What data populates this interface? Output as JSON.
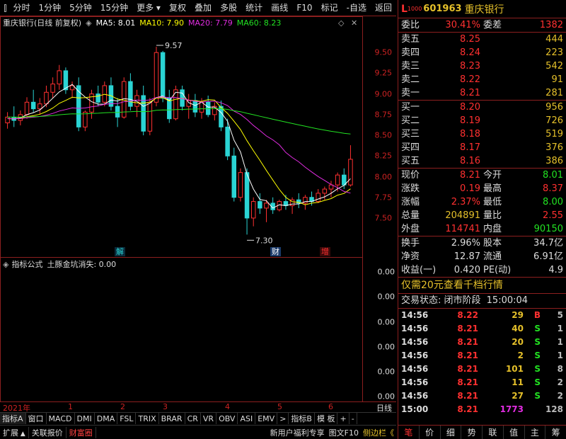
{
  "toolbar": {
    "left_items": [
      "分时",
      "1分钟",
      "5分钟",
      "15分钟",
      "更多"
    ],
    "right_items": [
      "复权",
      "叠加",
      "多股",
      "统计",
      "画线",
      "F10",
      "标记",
      "-自选",
      "返回"
    ]
  },
  "chart": {
    "stock_name": "重庆银行",
    "mode": "(日线 前复权)",
    "ma5": "MA5: 8.01",
    "ma10": "MA10: 7.90",
    "ma20": "MA20: 7.79",
    "ma60": "MA60: 8.23",
    "high_label": "9.57",
    "low_label": "7.30",
    "markers": [
      "解",
      "财",
      "增"
    ]
  },
  "chart_data": {
    "type": "candlestick",
    "y_ticks": [
      7.5,
      7.75,
      8.0,
      8.25,
      8.5,
      8.75,
      9.0,
      9.25,
      9.5
    ],
    "ylim": [
      7.2,
      9.75
    ],
    "colors": {
      "up": "#ff3030",
      "down": "#2ad4d4",
      "ma5": "#ffffff",
      "ma10": "#ffff00",
      "ma20": "#e02ce0",
      "ma60": "#22e222"
    },
    "candles": [
      [
        8.65,
        8.78,
        8.58,
        8.72
      ],
      [
        8.72,
        8.85,
        8.6,
        8.68
      ],
      [
        8.68,
        8.8,
        8.62,
        8.75
      ],
      [
        8.75,
        8.96,
        8.7,
        8.9
      ],
      [
        8.9,
        9.05,
        8.78,
        8.82
      ],
      [
        8.82,
        8.95,
        8.75,
        8.88
      ],
      [
        8.88,
        9.1,
        8.84,
        9.02
      ],
      [
        9.02,
        9.2,
        8.95,
        9.12
      ],
      [
        9.12,
        9.35,
        9.05,
        9.28
      ],
      [
        9.28,
        9.32,
        9.0,
        9.05
      ],
      [
        9.05,
        9.15,
        8.95,
        9.1
      ],
      [
        9.1,
        9.2,
        8.55,
        8.6
      ],
      [
        8.6,
        8.8,
        8.55,
        8.78
      ],
      [
        8.78,
        9.05,
        8.7,
        9.0
      ],
      [
        9.0,
        9.1,
        8.85,
        8.9
      ],
      [
        8.9,
        9.15,
        8.85,
        9.1
      ],
      [
        9.1,
        9.2,
        8.8,
        8.85
      ],
      [
        8.85,
        8.95,
        8.6,
        8.72
      ],
      [
        8.72,
        9.2,
        8.7,
        9.15
      ],
      [
        9.15,
        9.25,
        8.8,
        8.85
      ],
      [
        8.85,
        9.05,
        8.72,
        8.98
      ],
      [
        8.98,
        9.1,
        8.5,
        8.55
      ],
      [
        8.55,
        8.95,
        8.5,
        8.9
      ],
      [
        8.9,
        9.57,
        8.85,
        9.5
      ],
      [
        9.5,
        9.52,
        8.9,
        8.95
      ],
      [
        8.95,
        9.05,
        8.65,
        8.7
      ],
      [
        8.7,
        9.1,
        8.68,
        9.05
      ],
      [
        9.05,
        9.1,
        8.8,
        8.85
      ],
      [
        8.85,
        9.0,
        8.7,
        8.92
      ],
      [
        8.92,
        9.0,
        8.72,
        8.78
      ],
      [
        8.78,
        8.95,
        8.7,
        8.9
      ],
      [
        8.9,
        8.98,
        8.72,
        8.75
      ],
      [
        8.75,
        8.9,
        8.68,
        8.85
      ],
      [
        8.85,
        8.92,
        8.55,
        8.6
      ],
      [
        8.6,
        8.7,
        8.2,
        8.25
      ],
      [
        8.25,
        8.35,
        7.7,
        7.75
      ],
      [
        7.75,
        8.1,
        7.7,
        8.05
      ],
      [
        8.05,
        8.1,
        7.3,
        7.5
      ],
      [
        7.5,
        7.75,
        7.4,
        7.7
      ],
      [
        7.7,
        7.8,
        7.55,
        7.62
      ],
      [
        7.62,
        7.72,
        7.45,
        7.68
      ],
      [
        7.68,
        7.75,
        7.55,
        7.6
      ],
      [
        7.6,
        7.72,
        7.58,
        7.7
      ],
      [
        7.7,
        7.78,
        7.6,
        7.65
      ],
      [
        7.65,
        7.75,
        7.55,
        7.72
      ],
      [
        7.72,
        7.8,
        7.62,
        7.68
      ],
      [
        7.68,
        7.78,
        7.6,
        7.75
      ],
      [
        7.75,
        7.82,
        7.65,
        7.7
      ],
      [
        7.7,
        7.85,
        7.68,
        7.8
      ],
      [
        7.8,
        7.88,
        7.72,
        7.85
      ],
      [
        7.85,
        7.95,
        7.75,
        7.9
      ],
      [
        7.9,
        8.05,
        7.82,
        8.02
      ],
      [
        8.02,
        8.1,
        7.85,
        7.9
      ],
      [
        7.9,
        8.38,
        7.88,
        8.21
      ]
    ]
  },
  "indicator": {
    "title": "指标公式",
    "formula": "土豚金坑消失: 0.00",
    "axis_values": [
      "0.00",
      "0.00",
      "0.00",
      "0.00",
      "0.00",
      "0.00"
    ]
  },
  "date_axis": {
    "labels": [
      "2021年",
      "1",
      "2",
      "3",
      "4",
      "5",
      "6"
    ],
    "period": "日线"
  },
  "indicator_tabs": [
    "指标A",
    "窗口",
    "MACD",
    "DMI",
    "DMA",
    "FSL",
    "TRIX",
    "BRAR",
    "CR",
    "VR",
    "OBV",
    "ASI",
    "EMV",
    ">",
    "指标B",
    "模 板",
    "+",
    "-"
  ],
  "status_bar": {
    "tabs": [
      "扩展",
      "关联报价",
      "财富圈"
    ],
    "links": [
      "新用户福利专享",
      "图文F10",
      "侧边栏《"
    ]
  },
  "quote": {
    "level": "L",
    "level_sub": "1000",
    "code": "601963",
    "name": "重庆银行",
    "weibi_label": "委比",
    "weibi": "30.41%",
    "weicha_label": "委差",
    "weicha": "1382",
    "asks": [
      {
        "label": "卖五",
        "price": "8.25",
        "vol": "444"
      },
      {
        "label": "卖四",
        "price": "8.24",
        "vol": "223"
      },
      {
        "label": "卖三",
        "price": "8.23",
        "vol": "542"
      },
      {
        "label": "卖二",
        "price": "8.22",
        "vol": "91"
      },
      {
        "label": "卖一",
        "price": "8.21",
        "vol": "281"
      }
    ],
    "bids": [
      {
        "label": "买一",
        "price": "8.20",
        "vol": "956"
      },
      {
        "label": "买二",
        "price": "8.19",
        "vol": "726"
      },
      {
        "label": "买三",
        "price": "8.18",
        "vol": "519"
      },
      {
        "label": "买四",
        "price": "8.17",
        "vol": "376"
      },
      {
        "label": "买五",
        "price": "8.16",
        "vol": "386"
      }
    ],
    "stats": [
      {
        "l1": "现价",
        "v1": "8.21",
        "c1": "red",
        "l2": "今开",
        "v2": "8.01",
        "c2": "green"
      },
      {
        "l1": "涨跌",
        "v1": "0.19",
        "c1": "red",
        "l2": "最高",
        "v2": "8.37",
        "c2": "red"
      },
      {
        "l1": "涨幅",
        "v1": "2.37%",
        "c1": "red",
        "l2": "最低",
        "v2": "8.00",
        "c2": "green"
      },
      {
        "l1": "总量",
        "v1": "204891",
        "c1": "yellow",
        "l2": "量比",
        "v2": "2.55",
        "c2": "red"
      },
      {
        "l1": "外盘",
        "v1": "114741",
        "c1": "red",
        "l2": "内盘",
        "v2": "90150",
        "c2": "green"
      }
    ],
    "stats2": [
      {
        "l1": "换手",
        "v1": "2.96%",
        "l2": "股本",
        "v2": "34.7亿"
      },
      {
        "l1": "净资",
        "v1": "12.87",
        "l2": "流通",
        "v2": "6.91亿"
      },
      {
        "l1": "收益(一)",
        "v1": "0.420",
        "l2": "PE(动)",
        "v2": "4.9"
      }
    ],
    "promo": "仅需20元查看千档行情",
    "state_label": "交易状态: 闭市阶段",
    "state_time": "15:00:04",
    "ticks": [
      {
        "time": "14:56",
        "price": "8.22",
        "vol": "29",
        "bs": "B",
        "n": "5"
      },
      {
        "time": "14:56",
        "price": "8.21",
        "vol": "40",
        "bs": "S",
        "n": "1"
      },
      {
        "time": "14:56",
        "price": "8.21",
        "vol": "20",
        "bs": "S",
        "n": "1"
      },
      {
        "time": "14:56",
        "price": "8.21",
        "vol": "2",
        "bs": "S",
        "n": "1"
      },
      {
        "time": "14:56",
        "price": "8.21",
        "vol": "101",
        "bs": "S",
        "n": "8"
      },
      {
        "time": "14:56",
        "price": "8.21",
        "vol": "11",
        "bs": "S",
        "n": "2"
      },
      {
        "time": "14:56",
        "price": "8.21",
        "vol": "27",
        "bs": "S",
        "n": "2"
      },
      {
        "time": "15:00",
        "price": "8.21",
        "vol": "1773",
        "bs": "",
        "n": "128"
      }
    ],
    "bottom_tabs": [
      "笔",
      "价",
      "细",
      "势",
      "联",
      "值",
      "主",
      "筹"
    ]
  }
}
